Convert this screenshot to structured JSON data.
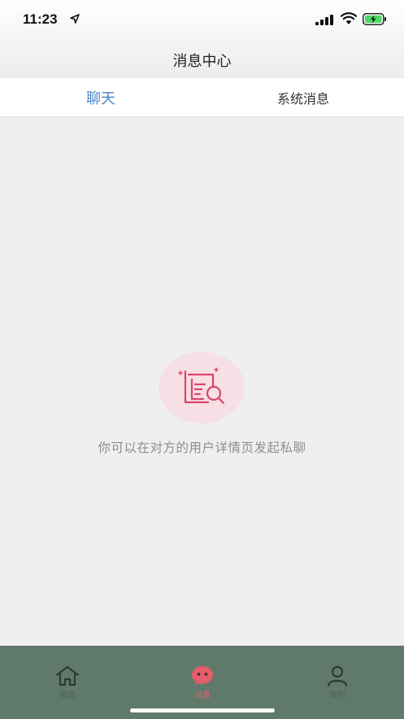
{
  "status_bar": {
    "time": "11:23"
  },
  "nav": {
    "title": "消息中心"
  },
  "tabs": [
    {
      "label": "聊天",
      "active": true
    },
    {
      "label": "系统消息",
      "active": false
    }
  ],
  "empty_state": {
    "icon": "document-search-icon",
    "message": "你可以在对方的用户详情页发起私聊"
  },
  "tab_bar": {
    "items": [
      {
        "label": "频道",
        "icon": "home-icon",
        "active": false
      },
      {
        "label": "消息",
        "icon": "message-face-icon",
        "active": true
      },
      {
        "label": "我的",
        "icon": "person-icon",
        "active": false
      }
    ]
  },
  "colors": {
    "accent": "#4a86c8",
    "active_tab": "#e35d6a",
    "tab_bar_bg": "#5f7a6b",
    "empty_icon": "#d9456a"
  }
}
